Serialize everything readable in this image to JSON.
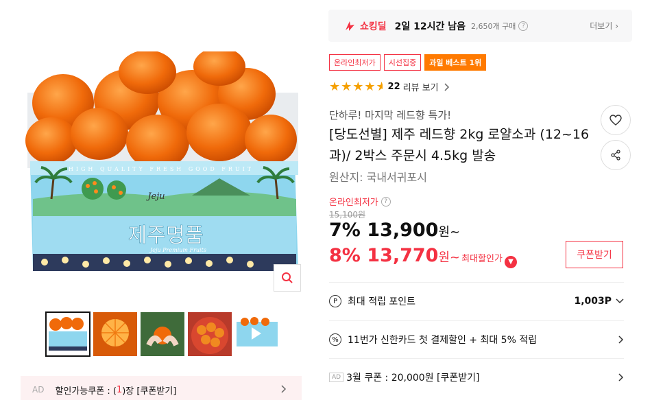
{
  "deal": {
    "label": "쇼킹딜",
    "timer": "2일 12시간 남음",
    "buy_count": "2,650개 구매",
    "more": "더보기",
    "icons": {
      "deal": "shocking-deal-icon",
      "help": "question-icon",
      "more": "chevron-right-icon"
    }
  },
  "badges": [
    "온라인최저가",
    "시선집중",
    "과일 베스트 1위"
  ],
  "rating": {
    "stars": 4.5,
    "review_count": "22",
    "review_label": "리뷰 보기"
  },
  "product": {
    "subtitle": "단하루! 마지막 레드향 특가!",
    "title": "[당도선별] 제주 레드향 2kg 로얄소과 (12~16과)/ 2박스 주문시 4.5kg 발송",
    "origin": "원산지:  국내서귀포시"
  },
  "image": {
    "box_top_text": "HIGH QUALITY FRESH GOOD FRUIT",
    "box_logo": "Jeju",
    "box_title": "제주명품",
    "box_subtitle": "Jeju Premium Fruits"
  },
  "price": {
    "lowest_label": "온라인최저가",
    "original": "15,100원",
    "discount1": "7%",
    "price1": "13,900",
    "won1": "원~",
    "discount2": "8%",
    "price2": "13,770",
    "won2": "원~",
    "max_discount_label": "최대할인가",
    "coupon_button": "쿠폰받기"
  },
  "rows": [
    {
      "icon": "P",
      "label": "최대 적립 포인트",
      "value": "1,003P"
    },
    {
      "icon": "%",
      "label": "11번가 신한카드 첫 결제할인 + 최대 5% 적립",
      "value": ""
    },
    {
      "icon": "AD",
      "label": "3월 쿠폰 : 20,000원 [쿠폰받기]",
      "value": ""
    }
  ],
  "coupon_banner": {
    "ad": "AD",
    "prefix": "할인가능쿠폰 : (",
    "count": "1",
    "suffix": ")장 [쿠폰받기]"
  },
  "colors": {
    "accent": "#f43142",
    "best_badge": "#ff7a00",
    "star": "#f5a000",
    "sky": "#8ed6ee"
  }
}
